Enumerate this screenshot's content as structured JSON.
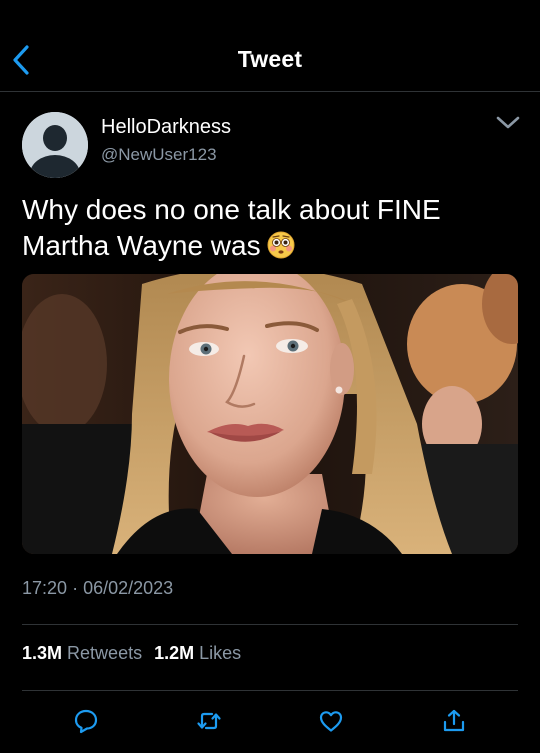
{
  "header": {
    "title": "Tweet",
    "back_icon": "chevron-left-icon"
  },
  "tweet": {
    "display_name": "HelloDarkness",
    "handle": "@NewUser123",
    "text": "Why does no one talk about FINE Martha Wayne was",
    "emoji": "flushed-face",
    "time": "17:20",
    "separator": "·",
    "date": "06/02/2023",
    "retweets_count": "1.3M",
    "retweets_label": "Retweets",
    "likes_count": "1.2M",
    "likes_label": "Likes"
  },
  "actions": [
    "reply-icon",
    "retweet-icon",
    "like-icon",
    "share-icon"
  ],
  "colors": {
    "background": "#000000",
    "accent": "#1d9bf0",
    "secondary_text": "#8b98a5",
    "divider": "#2f3336",
    "action_icon": "#1d9bf0"
  }
}
